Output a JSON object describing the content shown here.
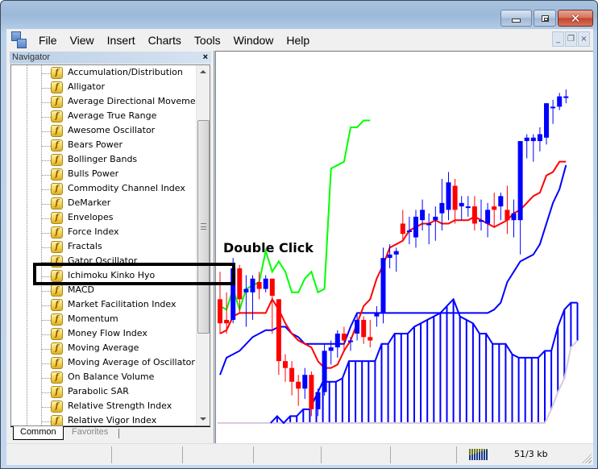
{
  "window": {
    "controls": {
      "minimize": "minimize",
      "maximize": "maximize",
      "close": "close"
    }
  },
  "menu": {
    "items": [
      "File",
      "View",
      "Insert",
      "Charts",
      "Tools",
      "Window",
      "Help"
    ],
    "mdi_controls": {
      "minimize": "_",
      "restore": "❐",
      "close": "×"
    }
  },
  "navigator": {
    "title": "Navigator",
    "close_glyph": "×",
    "items": [
      "Accumulation/Distribution",
      "Alligator",
      "Average Directional Movement",
      "Average True Range",
      "Awesome Oscillator",
      "Bears Power",
      "Bollinger Bands",
      "Bulls Power",
      "Commodity Channel Index",
      "DeMarker",
      "Envelopes",
      "Force Index",
      "Fractals",
      "Gator Oscillator",
      "Ichimoku Kinko Hyo",
      "MACD",
      "Market Facilitation Index",
      "Momentum",
      "Money Flow Index",
      "Moving Average",
      "Moving Average of Oscillator",
      "On Balance Volume",
      "Parabolic SAR",
      "Relative Strength Index",
      "Relative Vigor Index"
    ],
    "highlighted_item": "Ichimoku Kinko Hyo",
    "tabs": [
      "Common",
      "Favorites"
    ],
    "active_tab": "Common",
    "icon_glyph": "f"
  },
  "annotation": {
    "label": "Double Click"
  },
  "chart": {
    "colors": {
      "bull": "#0000ff",
      "bear": "#ff0000",
      "tenkan": "#ff0000",
      "kijun": "#0000ff",
      "chikou": "#00ff00",
      "span_a": "#0000ff",
      "span_b": "#d8c8e0",
      "cloud_hatch": "#0000ff"
    },
    "candles": [
      {
        "o": 0.4,
        "h": 0.48,
        "l": 0.3,
        "c": 0.33
      },
      {
        "o": 0.34,
        "h": 0.42,
        "l": 0.3,
        "c": 0.33
      },
      {
        "o": 0.34,
        "h": 0.52,
        "l": 0.33,
        "c": 0.49
      },
      {
        "o": 0.49,
        "h": 0.5,
        "l": 0.36,
        "c": 0.4
      },
      {
        "o": 0.42,
        "h": 0.47,
        "l": 0.32,
        "c": 0.43
      },
      {
        "o": 0.42,
        "h": 0.47,
        "l": 0.34,
        "c": 0.46
      },
      {
        "o": 0.45,
        "h": 0.48,
        "l": 0.4,
        "c": 0.43
      },
      {
        "o": 0.43,
        "h": 0.47,
        "l": 0.42,
        "c": 0.46
      },
      {
        "o": 0.46,
        "h": 0.46,
        "l": 0.3,
        "c": 0.41
      },
      {
        "o": 0.4,
        "h": 0.4,
        "l": 0.18,
        "c": 0.22
      },
      {
        "o": 0.22,
        "h": 0.24,
        "l": 0.16,
        "c": 0.2
      },
      {
        "o": 0.2,
        "h": 0.22,
        "l": 0.12,
        "c": 0.16
      },
      {
        "o": 0.16,
        "h": 0.18,
        "l": 0.09,
        "c": 0.14
      },
      {
        "o": 0.14,
        "h": 0.2,
        "l": 0.11,
        "c": 0.18
      },
      {
        "o": 0.18,
        "h": 0.19,
        "l": 0.06,
        "c": 0.08
      },
      {
        "o": 0.08,
        "h": 0.14,
        "l": 0.06,
        "c": 0.13
      },
      {
        "o": 0.13,
        "h": 0.27,
        "l": 0.12,
        "c": 0.25
      },
      {
        "o": 0.25,
        "h": 0.28,
        "l": 0.21,
        "c": 0.26
      },
      {
        "o": 0.26,
        "h": 0.31,
        "l": 0.23,
        "c": 0.3
      },
      {
        "o": 0.3,
        "h": 0.32,
        "l": 0.25,
        "c": 0.28
      },
      {
        "o": 0.28,
        "h": 0.29,
        "l": 0.25,
        "c": 0.28
      },
      {
        "o": 0.3,
        "h": 0.36,
        "l": 0.28,
        "c": 0.34
      },
      {
        "o": 0.34,
        "h": 0.35,
        "l": 0.27,
        "c": 0.29
      },
      {
        "o": 0.29,
        "h": 0.34,
        "l": 0.26,
        "c": 0.28
      },
      {
        "o": 0.35,
        "h": 0.38,
        "l": 0.32,
        "c": 0.36
      },
      {
        "o": 0.36,
        "h": 0.55,
        "l": 0.33,
        "c": 0.52
      },
      {
        "o": 0.52,
        "h": 0.56,
        "l": 0.49,
        "c": 0.53
      },
      {
        "o": 0.53,
        "h": 0.55,
        "l": 0.48,
        "c": 0.54
      },
      {
        "o": 0.62,
        "h": 0.66,
        "l": 0.57,
        "c": 0.59
      },
      {
        "o": 0.6,
        "h": 0.64,
        "l": 0.56,
        "c": 0.6
      },
      {
        "o": 0.58,
        "h": 0.66,
        "l": 0.55,
        "c": 0.64
      },
      {
        "o": 0.63,
        "h": 0.69,
        "l": 0.6,
        "c": 0.66
      },
      {
        "o": 0.62,
        "h": 0.65,
        "l": 0.56,
        "c": 0.62
      },
      {
        "o": 0.63,
        "h": 0.67,
        "l": 0.57,
        "c": 0.64
      },
      {
        "o": 0.65,
        "h": 0.75,
        "l": 0.6,
        "c": 0.68
      },
      {
        "o": 0.66,
        "h": 0.77,
        "l": 0.63,
        "c": 0.74
      },
      {
        "o": 0.73,
        "h": 0.75,
        "l": 0.62,
        "c": 0.66
      },
      {
        "o": 0.67,
        "h": 0.7,
        "l": 0.63,
        "c": 0.68
      },
      {
        "o": 0.67,
        "h": 0.7,
        "l": 0.64,
        "c": 0.67
      },
      {
        "o": 0.67,
        "h": 0.7,
        "l": 0.6,
        "c": 0.62
      },
      {
        "o": 0.63,
        "h": 0.69,
        "l": 0.6,
        "c": 0.63
      },
      {
        "o": 0.62,
        "h": 0.68,
        "l": 0.58,
        "c": 0.66
      },
      {
        "o": 0.67,
        "h": 0.71,
        "l": 0.61,
        "c": 0.66
      },
      {
        "o": 0.67,
        "h": 0.71,
        "l": 0.63,
        "c": 0.7
      },
      {
        "o": 0.66,
        "h": 0.73,
        "l": 0.59,
        "c": 0.63
      },
      {
        "o": 0.63,
        "h": 0.69,
        "l": 0.58,
        "c": 0.65
      },
      {
        "o": 0.63,
        "h": 0.69,
        "l": 0.53,
        "c": 0.86
      },
      {
        "o": 0.86,
        "h": 0.88,
        "l": 0.81,
        "c": 0.87
      },
      {
        "o": 0.86,
        "h": 0.88,
        "l": 0.8,
        "c": 0.87
      },
      {
        "o": 0.86,
        "h": 0.9,
        "l": 0.83,
        "c": 0.88
      },
      {
        "o": 0.87,
        "h": 0.97,
        "l": 0.85,
        "c": 0.97
      },
      {
        "o": 0.96,
        "h": 0.98,
        "l": 0.91,
        "c": 0.96
      },
      {
        "o": 0.96,
        "h": 1.0,
        "l": 0.95,
        "c": 0.99
      },
      {
        "o": 0.99,
        "h": 1.01,
        "l": 0.97,
        "c": 0.99
      }
    ],
    "tenkan": [
      0.3,
      0.31,
      0.35,
      0.36,
      0.36,
      0.36,
      0.36,
      0.36,
      0.4,
      0.37,
      0.33,
      0.3,
      0.28,
      0.27,
      0.26,
      0.22,
      0.2,
      0.2,
      0.21,
      0.25,
      0.28,
      0.33,
      0.38,
      0.4,
      0.46,
      0.5,
      0.55,
      0.56,
      0.57,
      0.6,
      0.61,
      0.62,
      0.62,
      0.63,
      0.62,
      0.62,
      0.63,
      0.63,
      0.63,
      0.64,
      0.63,
      0.62,
      0.61,
      0.62,
      0.63,
      0.65,
      0.66,
      0.68,
      0.7,
      0.71,
      0.76,
      0.77,
      0.8,
      0.8
    ],
    "kijun": [
      0.18,
      0.23,
      0.24,
      0.25,
      0.27,
      0.29,
      0.3,
      0.31,
      0.31,
      0.32,
      0.32,
      0.3,
      0.29,
      0.27,
      0.27,
      0.27,
      0.27,
      0.27,
      0.27,
      0.27,
      0.32,
      0.36,
      0.36,
      0.36,
      0.36,
      0.36,
      0.36,
      0.36,
      0.36,
      0.36,
      0.36,
      0.36,
      0.36,
      0.36,
      0.36,
      0.36,
      0.36,
      0.36,
      0.36,
      0.36,
      0.36,
      0.36,
      0.37,
      0.39,
      0.45,
      0.48,
      0.51,
      0.52,
      0.53,
      0.56,
      0.62,
      0.68,
      0.72,
      0.79
    ],
    "chikou": [
      0.38,
      0.37,
      0.43,
      0.37,
      0.43,
      0.44,
      0.45,
      0.54,
      0.48,
      0.51,
      0.48,
      0.42,
      0.42,
      0.46,
      0.48,
      0.42,
      0.43,
      0.78,
      0.79,
      0.8,
      0.9,
      0.9,
      0.92,
      0.92
    ],
    "span_a": [
      0.04,
      0.06,
      0.04,
      0.06,
      0.06,
      0.08,
      0.08,
      0.12,
      0.16,
      0.16,
      0.16,
      0.17,
      0.22,
      0.22,
      0.22,
      0.22,
      0.22,
      0.27,
      0.27,
      0.3,
      0.3,
      0.3,
      0.32,
      0.33,
      0.34,
      0.35,
      0.36,
      0.38,
      0.4,
      0.35,
      0.34,
      0.33,
      0.3,
      0.3,
      0.27,
      0.27,
      0.27,
      0.24,
      0.23,
      0.23,
      0.23,
      0.23,
      0.25,
      0.25,
      0.32,
      0.37,
      0.39,
      0.39
    ],
    "span_b": [
      0.04,
      0.04,
      0.04,
      0.04,
      0.04,
      0.04,
      0.04,
      0.04,
      0.04,
      0.04,
      0.04,
      0.04,
      0.04,
      0.04,
      0.04,
      0.04,
      0.04,
      0.04,
      0.04,
      0.04,
      0.04,
      0.04,
      0.04,
      0.04,
      0.04,
      0.04,
      0.04,
      0.04,
      0.04,
      0.04,
      0.04,
      0.04,
      0.04,
      0.04,
      0.04,
      0.04,
      0.04,
      0.04,
      0.04,
      0.04,
      0.04,
      0.04,
      0.04,
      0.08,
      0.13,
      0.17,
      0.26,
      0.28
    ]
  },
  "statusbar": {
    "traffic": "51/3 kb"
  }
}
